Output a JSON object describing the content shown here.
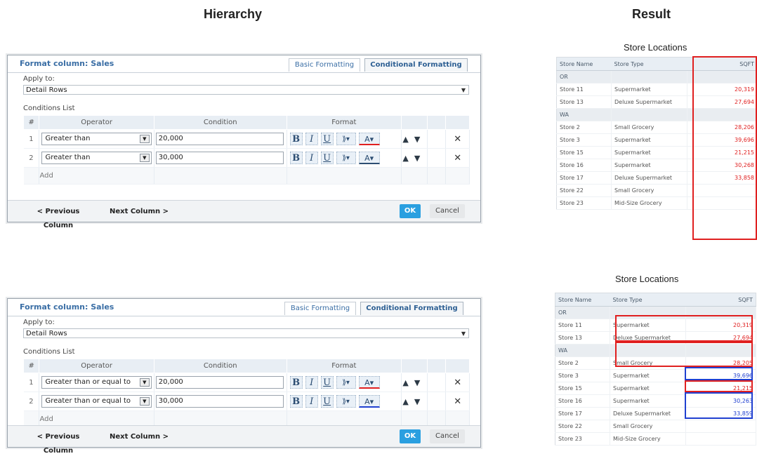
{
  "headings": {
    "hierarchy": "Hierarchy",
    "result": "Result"
  },
  "dialogs": [
    {
      "title": "Format column: Sales",
      "tabs": [
        "Basic Formatting",
        "Conditional Formatting"
      ],
      "active_tab": "Conditional Formatting",
      "apply_to_label": "Apply to:",
      "apply_to_value": "Detail Rows",
      "conditions_label": "Conditions List",
      "columns": [
        "#",
        "Operator",
        "Condition",
        "Format"
      ],
      "rows": [
        {
          "index": "1",
          "operator": "Greater than",
          "condition": "20,000",
          "font_color": "#e02020"
        },
        {
          "index": "2",
          "operator": "Greater than",
          "condition": "30,000",
          "font_color": "#2d4e73"
        }
      ],
      "add_label": "Add",
      "prev_label": "< Previous Column",
      "next_label": "Next Column >",
      "ok_label": "OK",
      "cancel_label": "Cancel",
      "format_icons": [
        "bold-icon",
        "italic-icon",
        "underline-icon",
        "fill-color-icon",
        "font-color-icon"
      ]
    },
    {
      "title": "Format column: Sales",
      "tabs": [
        "Basic Formatting",
        "Conditional Formatting"
      ],
      "active_tab": "Conditional Formatting",
      "apply_to_label": "Apply to:",
      "apply_to_value": "Detail Rows",
      "conditions_label": "Conditions List",
      "columns": [
        "#",
        "Operator",
        "Condition",
        "Format"
      ],
      "rows": [
        {
          "index": "1",
          "operator": "Greater than or equal to",
          "condition": "20,000",
          "font_color": "#e02020"
        },
        {
          "index": "2",
          "operator": "Greater than or equal to",
          "condition": "30,000",
          "font_color": "#2040d0"
        }
      ],
      "add_label": "Add",
      "prev_label": "< Previous Column",
      "next_label": "Next Column >",
      "ok_label": "OK",
      "cancel_label": "Cancel",
      "format_icons": [
        "bold-icon",
        "italic-icon",
        "underline-icon",
        "fill-color-icon",
        "font-color-icon"
      ]
    }
  ],
  "glyphs": {
    "bold": "B",
    "italic": "I",
    "underline": "U",
    "fill": "⟫▾",
    "font": "A▾",
    "up": "▲",
    "down": "▼",
    "remove": "✕",
    "caret": "▼"
  },
  "results": [
    {
      "title": "Store Locations",
      "columns": [
        "Store Name",
        "Store Type",
        "SQFT"
      ],
      "rows": [
        {
          "group": "OR"
        },
        {
          "name": "Store 11",
          "type": "Supermarket",
          "sqft": "20,319",
          "color": "#e02020"
        },
        {
          "name": "Store 13",
          "type": "Deluxe Supermarket",
          "sqft": "27,694",
          "color": "#e02020"
        },
        {
          "group": "WA"
        },
        {
          "name": "Store 2",
          "type": "Small Grocery",
          "sqft": "28,206",
          "color": "#e02020"
        },
        {
          "name": "Store 3",
          "type": "Supermarket",
          "sqft": "39,696",
          "color": "#e02020"
        },
        {
          "name": "Store 15",
          "type": "Supermarket",
          "sqft": "21,215",
          "color": "#e02020"
        },
        {
          "name": "Store 16",
          "type": "Supermarket",
          "sqft": "30,268",
          "color": "#e02020"
        },
        {
          "name": "Store 17",
          "type": "Deluxe Supermarket",
          "sqft": "33,858",
          "color": "#e02020"
        },
        {
          "name": "Store 22",
          "type": "Small Grocery",
          "sqft": ""
        },
        {
          "name": "Store 23",
          "type": "Mid-Size Grocery",
          "sqft": ""
        }
      ],
      "highlight_color": "#e02020"
    },
    {
      "title": "Store Locations",
      "columns": [
        "Store Name",
        "Store Type",
        "SQFT"
      ],
      "rows": [
        {
          "group": "OR"
        },
        {
          "name": "Store 11",
          "type": "Supermarket",
          "sqft": "20,319",
          "color": "#e02020"
        },
        {
          "name": "Store 13",
          "type": "Deluxe Supermarket",
          "sqft": "27,694",
          "color": "#e02020"
        },
        {
          "group": "WA"
        },
        {
          "name": "Store 2",
          "type": "Small Grocery",
          "sqft": "28,205",
          "color": "#e02020"
        },
        {
          "name": "Store 3",
          "type": "Supermarket",
          "sqft": "39,696",
          "color": "#2040d0"
        },
        {
          "name": "Store 15",
          "type": "Supermarket",
          "sqft": "21,215",
          "color": "#e02020"
        },
        {
          "name": "Store 16",
          "type": "Supermarket",
          "sqft": "30,263",
          "color": "#2040d0"
        },
        {
          "name": "Store 17",
          "type": "Deluxe Supermarket",
          "sqft": "33,859",
          "color": "#2040d0"
        },
        {
          "name": "Store 22",
          "type": "Small Grocery",
          "sqft": ""
        },
        {
          "name": "Store 23",
          "type": "Mid-Size Grocery",
          "sqft": ""
        }
      ],
      "highlight_color": "#e02020",
      "highlight_color_2": "#2040d0"
    }
  ]
}
